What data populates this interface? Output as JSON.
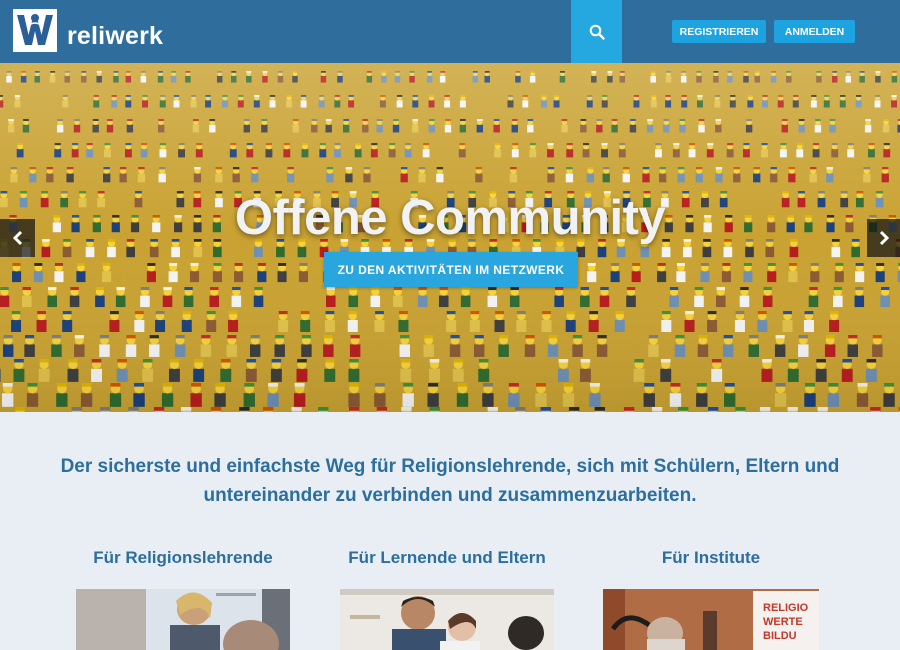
{
  "header": {
    "brand_name": "reliwerk",
    "search_icon": "search-icon",
    "register_label": "REGISTRIEREN",
    "login_label": "ANMELDEN",
    "colors": {
      "bar": "#2f6e9c",
      "accent": "#1ea3e1"
    }
  },
  "hero": {
    "title": "Offene Community",
    "cta_label": "ZU DEN AKTIVITÄTEN IM NETZWERK",
    "prev_icon": "chevron-left-icon",
    "next_icon": "chevron-right-icon"
  },
  "intro": {
    "text": "Der sicherste und einfachste Weg für Religionslehrende, sich mit Schülern, Eltern und untereinander zu verbinden und zusammenzuarbeiten."
  },
  "audiences": [
    {
      "title": "Für Religionslehrende"
    },
    {
      "title": "Für Lernende und Eltern"
    },
    {
      "title": "Für Institute",
      "image_text": "RELIGIO WERTE BILDU"
    }
  ]
}
